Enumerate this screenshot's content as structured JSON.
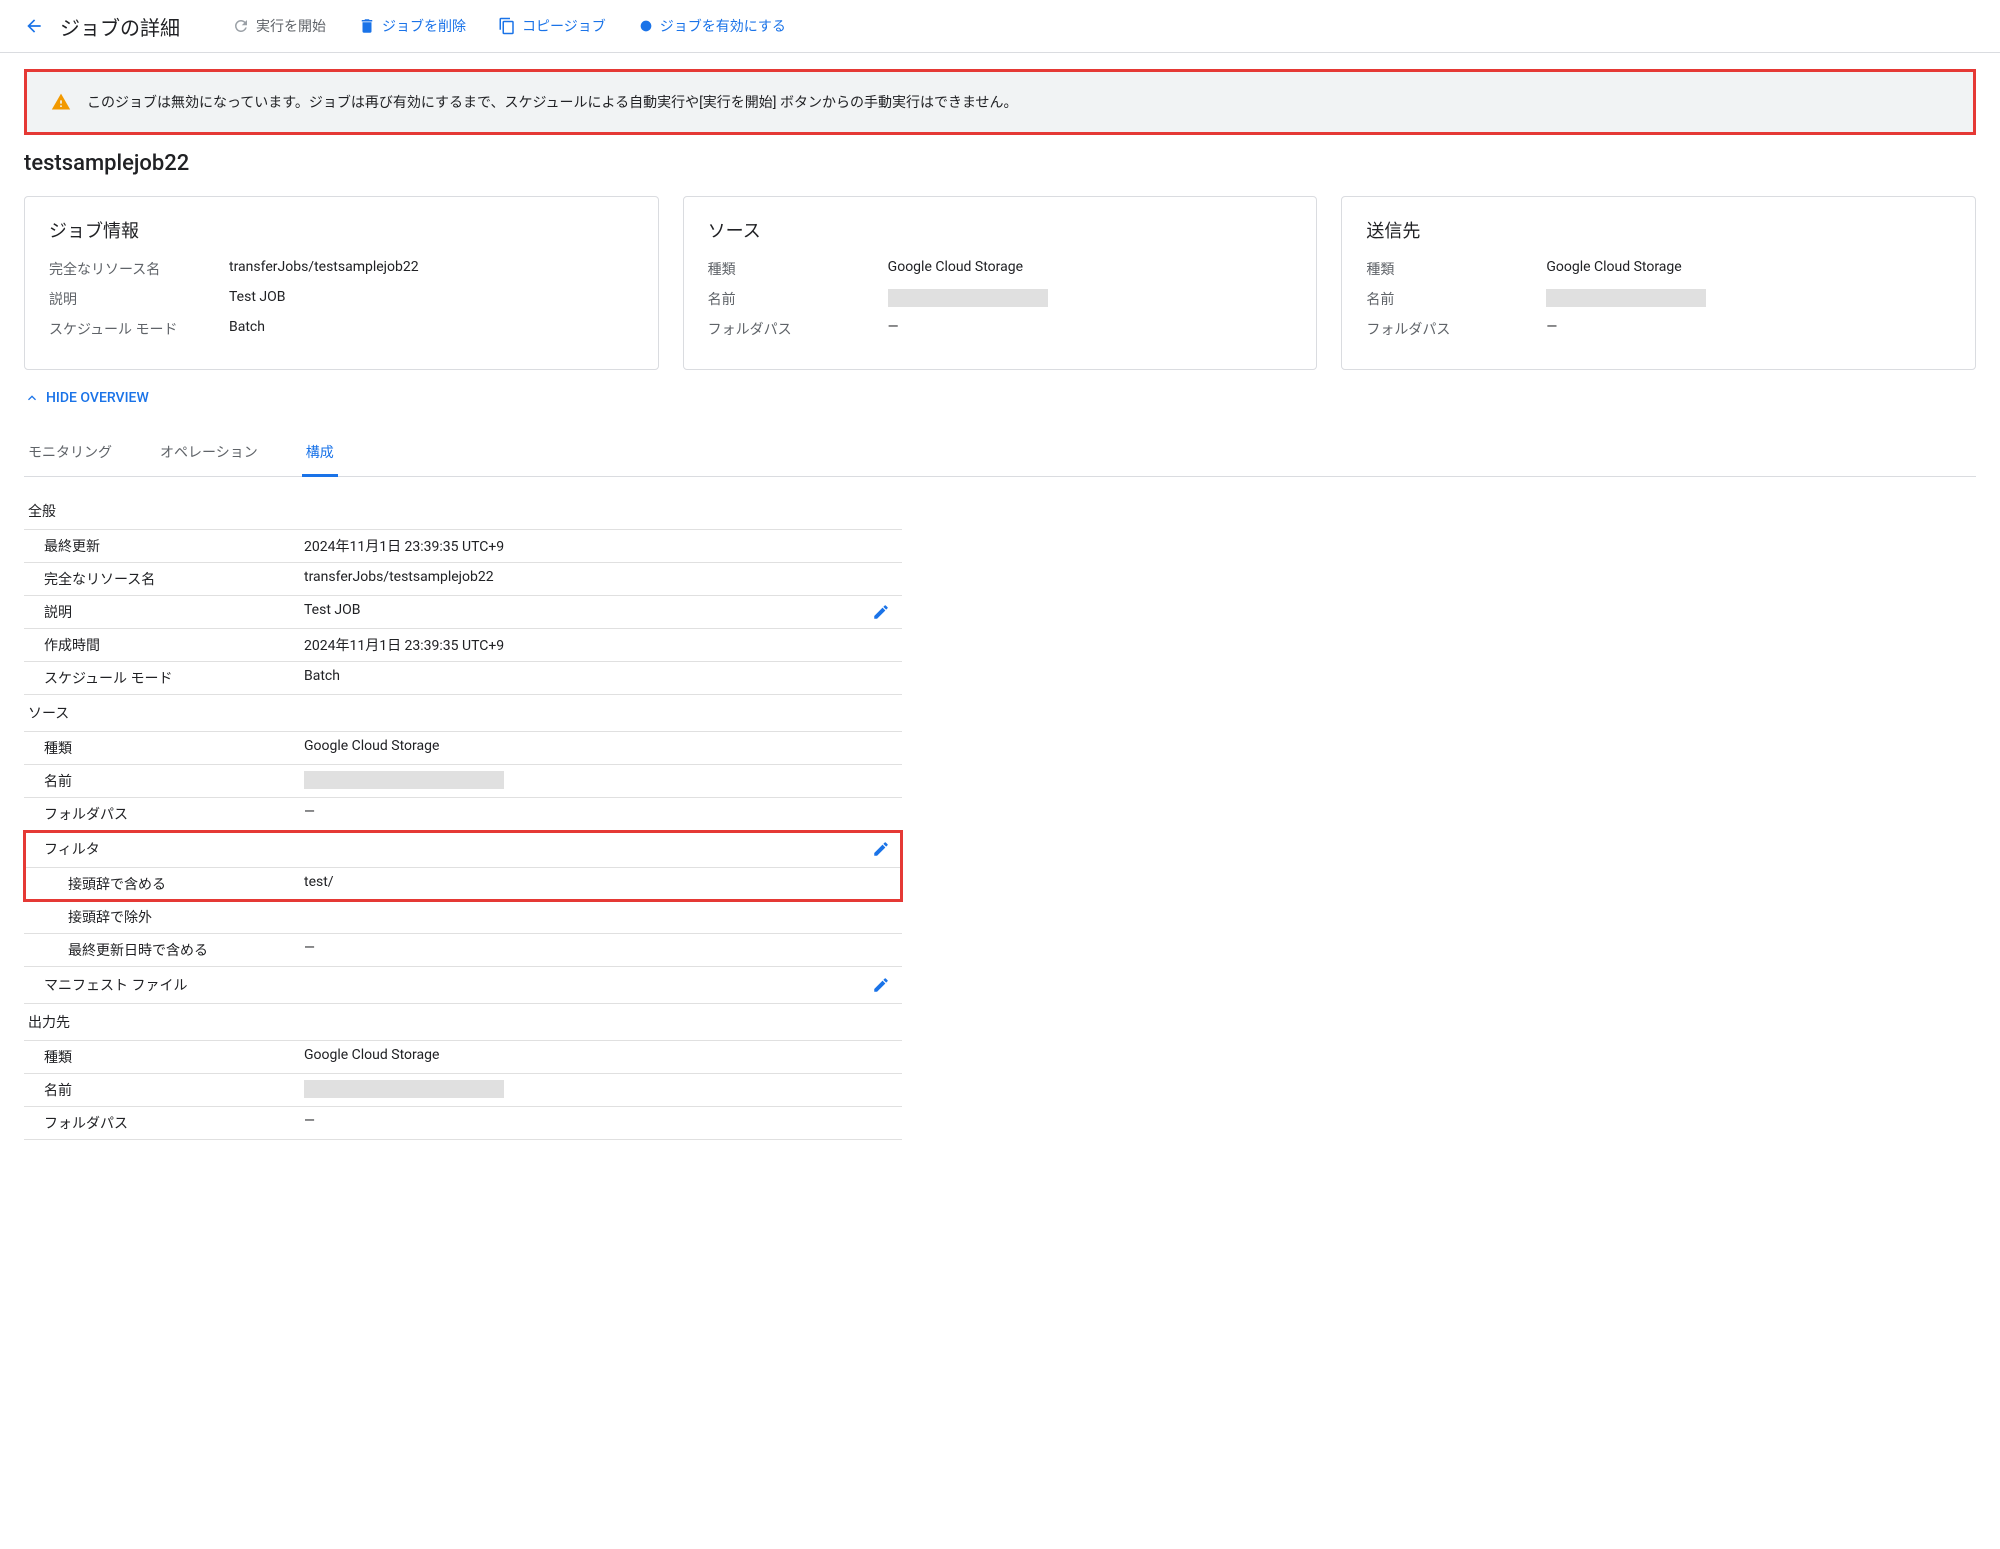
{
  "toolbar": {
    "title": "ジョブの詳細",
    "start_run": "実行を開始",
    "delete_job": "ジョブを削除",
    "copy_job": "コピージョブ",
    "enable_job": "ジョブを有効にする"
  },
  "alert": {
    "message": "このジョブは無効になっています。ジョブは再び有効にするまで、スケジュールによる自動実行や[実行を開始] ボタンからの手動実行はできません。"
  },
  "job_name": "testsamplejob22",
  "cards": {
    "info": {
      "title": "ジョブ情報",
      "resource_name_label": "完全なリソース名",
      "resource_name_value": "transferJobs/testsamplejob22",
      "description_label": "説明",
      "description_value": "Test JOB",
      "schedule_label": "スケジュール モード",
      "schedule_value": "Batch"
    },
    "source": {
      "title": "ソース",
      "type_label": "種類",
      "type_value": "Google Cloud Storage",
      "name_label": "名前",
      "folder_label": "フォルダパス",
      "folder_value": "—"
    },
    "dest": {
      "title": "送信先",
      "type_label": "種類",
      "type_value": "Google Cloud Storage",
      "name_label": "名前",
      "folder_label": "フォルダパス",
      "folder_value": "—"
    }
  },
  "hide_overview": "HIDE OVERVIEW",
  "tabs": {
    "monitoring": "モニタリング",
    "operations": "オペレーション",
    "config": "構成"
  },
  "config": {
    "general": {
      "header": "全般",
      "last_updated_label": "最終更新",
      "last_updated_value": "2024年11月1日 23:39:35 UTC+9",
      "resource_name_label": "完全なリソース名",
      "resource_name_value": "transferJobs/testsamplejob22",
      "description_label": "説明",
      "description_value": "Test JOB",
      "created_label": "作成時間",
      "created_value": "2024年11月1日 23:39:35 UTC+9",
      "schedule_label": "スケジュール モード",
      "schedule_value": "Batch"
    },
    "source": {
      "header": "ソース",
      "type_label": "種類",
      "type_value": "Google Cloud Storage",
      "name_label": "名前",
      "folder_label": "フォルダパス",
      "folder_value": "—"
    },
    "filter": {
      "header": "フィルタ",
      "include_prefix_label": "接頭辞で含める",
      "include_prefix_value": "test/",
      "exclude_prefix_label": "接頭辞で除外",
      "exclude_prefix_value": "",
      "include_modified_label": "最終更新日時で含める",
      "include_modified_value": "—"
    },
    "manifest": {
      "header": "マニフェスト ファイル"
    },
    "output": {
      "header": "出力先",
      "type_label": "種類",
      "type_value": "Google Cloud Storage",
      "name_label": "名前",
      "folder_label": "フォルダパス",
      "folder_value": "—"
    }
  }
}
